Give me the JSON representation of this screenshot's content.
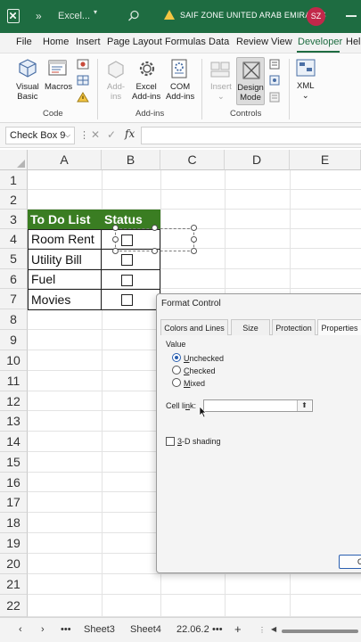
{
  "titlebar": {
    "file_name": "Excel...",
    "collapse_glyph": "»",
    "warning_text": "SAIF ZONE UNITED ARAB EMIRATES",
    "avatar_initials": "SZ"
  },
  "ribbon_tabs": [
    "File",
    "Home",
    "Insert",
    "Page Layout",
    "Formulas",
    "Data",
    "Review",
    "View",
    "Developer",
    "Help"
  ],
  "ribbon": {
    "code": {
      "visual_basic": [
        "Visual",
        "Basic"
      ],
      "macros": "Macros",
      "group": "Code"
    },
    "addins": {
      "addins": [
        "Add-",
        "ins"
      ],
      "excel_addins": [
        "Excel",
        "Add-ins"
      ],
      "com_addins": [
        "COM",
        "Add-ins"
      ],
      "group": "Add-ins"
    },
    "controls": {
      "insert": "Insert",
      "design_mode": [
        "Design",
        "Mode"
      ],
      "group": "Controls"
    },
    "xml": {
      "label": "XML"
    }
  },
  "formula_bar": {
    "name_box": "Check Box 9",
    "fx": "fx"
  },
  "grid": {
    "columns": [
      "A",
      "B",
      "C",
      "D",
      "E"
    ],
    "rows": [
      "1",
      "2",
      "3",
      "4",
      "5",
      "6",
      "7",
      "8",
      "9",
      "10",
      "11",
      "12",
      "13",
      "14",
      "15",
      "16",
      "17",
      "18",
      "19",
      "20",
      "21",
      "22"
    ],
    "header_todo": "To Do List",
    "header_status": "Status",
    "items": [
      "Room Rent",
      "Utility Bill",
      "Fuel",
      "Movies"
    ]
  },
  "dialog": {
    "title": "Format Control",
    "tabs": [
      "Colors and Lines",
      "Size",
      "Protection",
      "Properties"
    ],
    "value_group": "Value",
    "options": [
      {
        "label": "Unchecked",
        "selected": true
      },
      {
        "label": "Checked",
        "selected": false
      },
      {
        "label": "Mixed",
        "selected": false
      }
    ],
    "cell_link_label": "Cell link:",
    "cell_link_value": "",
    "shading_label": "3-D shading",
    "ok_label": "O"
  },
  "sheetbar": {
    "tabs": [
      "Sheet3",
      "Sheet4",
      "22.06.2"
    ],
    "add_glyph": "+"
  },
  "colors": {
    "excel_green": "#1e6c41",
    "header_fill": "#3a7d22",
    "warning": "#f4c542",
    "avatar": "#c2284a"
  }
}
